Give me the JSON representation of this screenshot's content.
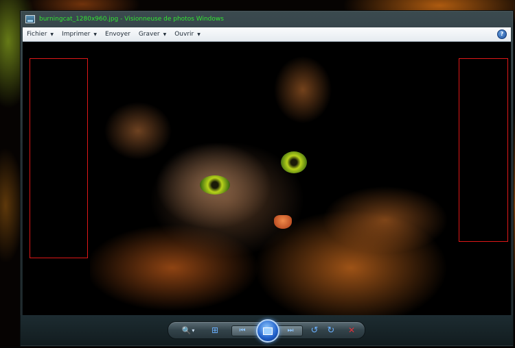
{
  "window": {
    "title": "burningcat_1280x960.jpg - Visionneuse de photos Windows"
  },
  "menubar": {
    "items": [
      {
        "label": "Fichier",
        "has_dropdown": true
      },
      {
        "label": "Imprimer",
        "has_dropdown": true
      },
      {
        "label": "Envoyer",
        "has_dropdown": false
      },
      {
        "label": "Graver",
        "has_dropdown": true
      },
      {
        "label": "Ouvrir",
        "has_dropdown": true
      }
    ],
    "help_glyph": "?"
  },
  "icons": {
    "app": "photo-viewer-icon",
    "help": "help-icon",
    "zoom": "magnifier-icon",
    "fit": "actual-size-icon",
    "previous": "previous-icon",
    "slideshow": "slideshow-icon",
    "next": "next-icon",
    "rotate_ccw": "rotate-counterclockwise-icon",
    "rotate_cw": "rotate-clockwise-icon",
    "delete": "delete-icon"
  },
  "colors": {
    "title_text": "#33e633",
    "highlight_box": "#e01818",
    "delete": "#e0303a",
    "control_icons": "#6ab0ff"
  },
  "glyphs": {
    "zoom": "🔍",
    "zoom_caret": "▾",
    "fit": "⊞",
    "previous": "⏮",
    "next": "⏭",
    "rotate_ccw": "↺",
    "rotate_cw": "↻",
    "delete": "✕",
    "menu_caret": "▼"
  }
}
